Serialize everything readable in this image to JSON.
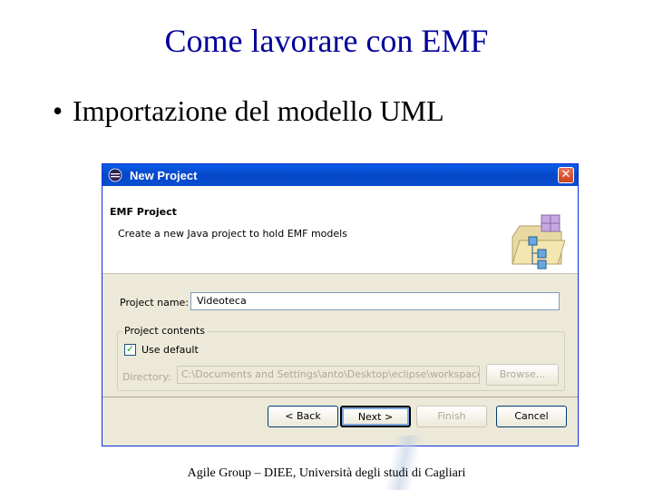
{
  "slide": {
    "title": "Come lavorare con EMF",
    "bullet": "Importazione del modello UML",
    "bullet_marker": "•",
    "footer": "Agile Group – DIEE, Università degli studi di Cagliari"
  },
  "dialog": {
    "app_icon": "eclipse-icon",
    "title": "New Project",
    "close_glyph": "✕",
    "header": {
      "title": "EMF Project",
      "description": "Create a new Java project to hold EMF models",
      "icon": "new-project-wizard-icon"
    },
    "project_name_label": "Project name:",
    "project_name_value": "Videoteca",
    "group_label": "Project contents",
    "use_default_label": "Use default",
    "use_default_checked": "✓",
    "directory_label": "Directory:",
    "directory_value": "C:\\Documents and Settings\\anto\\Desktop\\eclipse\\workspace\\Vic",
    "browse_label": "Browse...",
    "buttons": {
      "back": "< Back",
      "next": "Next >",
      "finish": "Finish",
      "cancel": "Cancel"
    }
  },
  "colors": {
    "title_blue": "#000099",
    "titlebar_blue": "#0a5ee8",
    "dialog_bg": "#ece9d8"
  }
}
